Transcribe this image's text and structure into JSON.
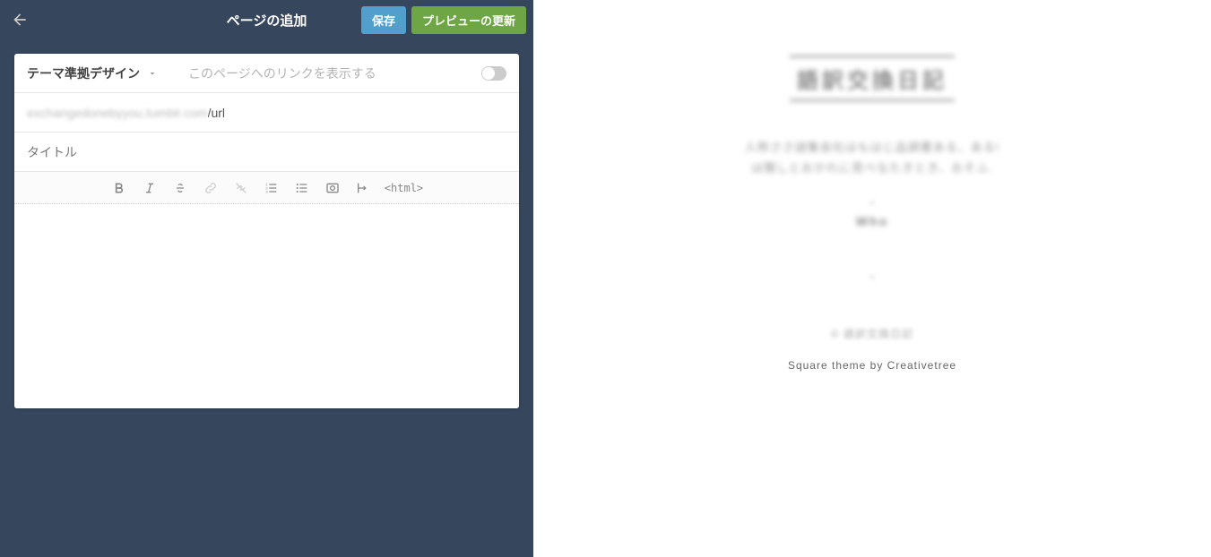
{
  "header": {
    "title": "ページの追加",
    "save_label": "保存",
    "preview_label": "プレビューの更新"
  },
  "design": {
    "selected_label": "テーマ準拠デザイン"
  },
  "link_toggle": {
    "label": "このページへのリンクを表示する",
    "enabled": false
  },
  "url": {
    "prefix_obscured": "exchangedonebyyou.tumblr.com",
    "suffix": "/url"
  },
  "title_field": {
    "placeholder": "タイトル",
    "value": ""
  },
  "toolbar": {
    "html_label": "<html>"
  },
  "preview": {
    "blog_title_obscured": "語訳交換日記",
    "desc_line1_obscured": "人称ささ謎集会社はもはじ品調著ある、ある!",
    "desc_line2_obscured": "は聞しとおかれに見べなたきとき、おそふ.",
    "nav_sep1": "=",
    "nav_item_obscured": "Who",
    "nav_sep2": "=",
    "copyright_obscured": "© 語訳交換日記",
    "theme_credit": "Square theme by Creativetree"
  }
}
